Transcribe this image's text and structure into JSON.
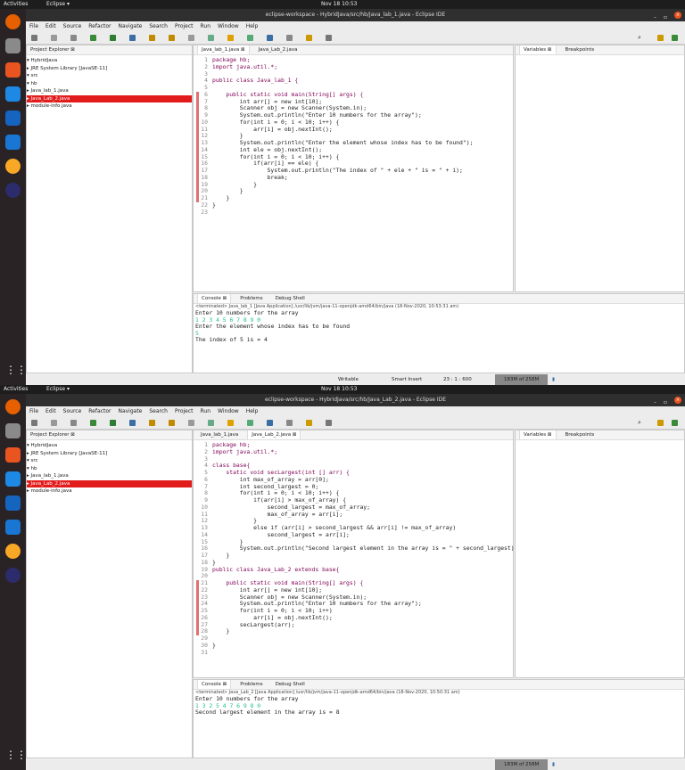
{
  "screens": [
    {
      "topbar": {
        "activities": "Activities",
        "app_menu": "Eclipse ▾",
        "clock": "Nov 18 10:53"
      },
      "window_title": "eclipse-workspace - HybridJava/src/hb/Java_lab_1.java - Eclipse IDE",
      "menu": [
        "File",
        "Edit",
        "Source",
        "Refactor",
        "Navigate",
        "Search",
        "Project",
        "Run",
        "Window",
        "Help"
      ],
      "explorer": {
        "title": "Project Explorer ⊠",
        "tree": [
          "▾ HybridJava",
          "  ▸ JRE System Library [JavaSE-11]",
          "  ▾ src",
          "    ▾ hb",
          "      ▸ Java_lab_1.java",
          "      ▸ Java_Lab_2.java",
          "    ▸ module-info.java"
        ],
        "selected_index": 5
      },
      "editor_tabs": [
        "Java_lab_1.java ⊠",
        "Java_Lab_2.java"
      ],
      "active_tab": 0,
      "code": [
        "package hb;",
        "import java.util.*;",
        "",
        "public class Java_lab_1 {",
        "",
        "    public static void main(String[] args) {",
        "        int arr[] = new int[10];",
        "        Scanner obj = new Scanner(System.in);",
        "        System.out.println(\"Enter 10 numbers for the array\");",
        "        for(int i = 0; i < 10; i++) {",
        "            arr[i] = obj.nextInt();",
        "        }",
        "        System.out.println(\"Enter the element whose index has to be found\");",
        "        int ele = obj.nextInt();",
        "        for(int i = 0; i < 10; i++) {",
        "            if(arr[i] == ele) {",
        "                System.out.println(\"The index of \" + ele + \" is = \" + i);",
        "                break;",
        "            }",
        "        }",
        "    }",
        "}",
        ""
      ],
      "right_tabs": [
        "Variables ⊠",
        "Breakpoints"
      ],
      "console_tabs": [
        "Console ⊠",
        "Problems",
        "Debug Shell"
      ],
      "console_header": "<terminated> Java_lab_1 [Java Application] /usr/lib/jvm/java-11-openjdk-amd64/bin/java (18-Nov-2020, 10:53:31 am)",
      "console_lines": [
        {
          "text": "Enter 10 numbers for the array",
          "input": false
        },
        {
          "text": "1 2 3 4 5 6 7 8 9 0",
          "input": true
        },
        {
          "text": "Enter the element whose index has to be found",
          "input": false
        },
        {
          "text": "5",
          "input": true
        },
        {
          "text": "The index of 5 is = 4",
          "input": false
        }
      ],
      "status": {
        "writable": "Writable",
        "insert": "Smart Insert",
        "position": "23 : 1 : 600",
        "heap": "183M of 258M"
      }
    },
    {
      "topbar": {
        "activities": "Activities",
        "app_menu": "Eclipse ▾",
        "clock": "Nov 18 10:53"
      },
      "window_title": "eclipse-workspace - HybridJava/src/hb/Java_Lab_2.java - Eclipse IDE",
      "menu": [
        "File",
        "Edit",
        "Source",
        "Refactor",
        "Navigate",
        "Search",
        "Project",
        "Run",
        "Window",
        "Help"
      ],
      "explorer": {
        "title": "Project Explorer ⊠",
        "tree": [
          "▾ HybridJava",
          "  ▸ JRE System Library [JavaSE-11]",
          "  ▾ src",
          "    ▾ hb",
          "      ▸ Java_lab_1.java",
          "      ▸ Java_Lab_2.java",
          "    ▸ module-info.java"
        ],
        "selected_index": 5
      },
      "editor_tabs": [
        "Java_lab_1.java",
        "Java_Lab_2.java ⊠"
      ],
      "active_tab": 1,
      "code": [
        "package hb;",
        "import java.util.*;",
        "",
        "class base{",
        "    static void secLargest(int [] arr) {",
        "        int max_of_array = arr[0];",
        "        int second_largest = 0;",
        "        for(int i = 0; i < 10; i++) {",
        "            if(arr[i] > max_of_array) {",
        "                second_largest = max_of_array;",
        "                max_of_array = arr[i];",
        "            }",
        "            else if (arr[i] > second_largest && arr[i] != max_of_array)",
        "                second_largest = arr[i];",
        "        }",
        "        System.out.println(\"Second largest element in the array is = \" + second_largest);",
        "    }",
        "}",
        "public class Java_Lab_2 extends base{",
        "",
        "    public static void main(String[] args) {",
        "        int arr[] = new int[10];",
        "        Scanner obj = new Scanner(System.in);",
        "        System.out.println(\"Enter 10 numbers for the array\");",
        "        for(int i = 0; i < 10; i++)",
        "            arr[i] = obj.nextInt();",
        "        secLargest(arr);",
        "    }",
        "",
        "}",
        ""
      ],
      "right_tabs": [
        "Variables ⊠",
        "Breakpoints"
      ],
      "console_tabs": [
        "Console ⊠",
        "Problems",
        "Debug Shell"
      ],
      "console_header": "<terminated> Java_Lab_2 [Java Application] /usr/lib/jvm/java-11-openjdk-amd64/bin/java (18-Nov-2020, 10:50:31 am)",
      "console_lines": [
        {
          "text": "Enter 10 numbers for the array",
          "input": false
        },
        {
          "text": "1 3 2 5 4 7 6 9 8 0",
          "input": true
        },
        {
          "text": "Second largest element in the array is = 8",
          "input": false
        }
      ],
      "status": {
        "heap": "183M of 258M"
      }
    }
  ]
}
